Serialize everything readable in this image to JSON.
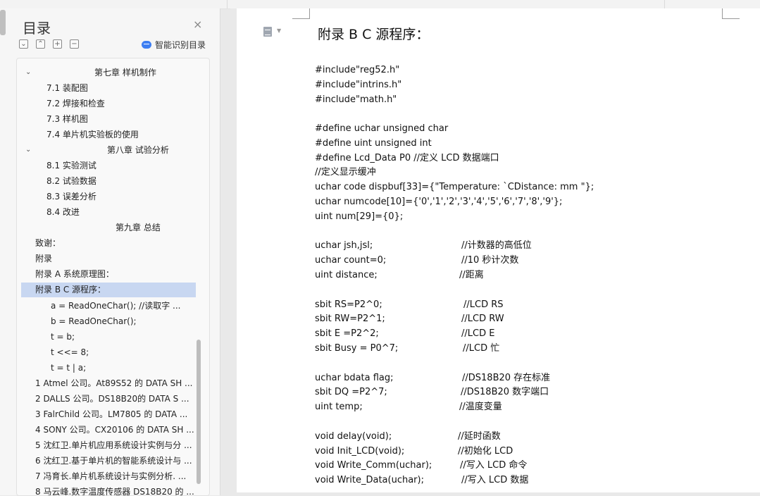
{
  "toc": {
    "title": "目录",
    "close": "×",
    "tools": [
      "⌄",
      "⌃",
      "+",
      "−"
    ],
    "smart_label": "智能识别目录",
    "items": [
      "第七章  样机制作",
      "7.1  装配图",
      "7.2  焊接和检查",
      "7.3  样机图",
      "7.4  单片机实验板的使用",
      "第八章  试验分析",
      "8.1  实验测试",
      "8.2  试验数据",
      "8.3  误差分析",
      "8.4  改进",
      "第九章  总结",
      "致谢：",
      "附录",
      "附录 A    系统原理图：",
      "附录 B  C 源程序：",
      "a  =  ReadOneChar();    //读取字 ...",
      "b  =  ReadOneChar();",
      "t  =  b;",
      "t  <<=  8;",
      "t  =  t  |  a;",
      "1  Atmel 公司。At89S52 的 DATA  SH ...",
      "2  DALLS 公司。DS18B20的 DATA  S ...",
      "3  FalrChild 公司。LM7805 的 DATA  ...",
      "4  SONY 公司。CX20106 的 DATA  SH ...",
      "5  沈红卫.单片机应用系统设计实例与分 ...",
      "6  沈红卫.基于单片机的智能系统设计与 ...",
      "7  冯育长.单片机系统设计与实例分析. ...",
      "8  马云峰.数字温度传感器 DS18B20 的 ..."
    ]
  },
  "doc": {
    "heading": "附录 B  C 源程序：",
    "lines": [
      {
        "code": "#include\"reg52.h\"",
        "comment": ""
      },
      {
        "code": "#include\"intrins.h\"",
        "comment": ""
      },
      {
        "code": "#include\"math.h\"",
        "comment": ""
      },
      {
        "code": "#define  uchar  unsigned  char",
        "comment": ""
      },
      {
        "code": "#define  uint    unsigned  int",
        "comment": ""
      },
      {
        "code": "#define  Lcd_Data    P0  //定义 LCD 数据端口",
        "comment": ""
      },
      {
        "code": "//定义显示缓冲",
        "comment": ""
      },
      {
        "code": "uchar  code  dispbuf[33]={\"Temperature:    `CDistance:        mm  \"};",
        "comment": ""
      },
      {
        "code": "uchar  numcode[10]={'0','1','2','3','4','5','6','7','8','9'};",
        "comment": ""
      },
      {
        "code": "uint  num[29]={0};",
        "comment": ""
      },
      {
        "code": "uchar  jsh,jsl;",
        "comment": "//计数器的高低位"
      },
      {
        "code": "uchar  count=0;",
        "comment": "//10 秒计次数"
      },
      {
        "code": "uint  distance;",
        "comment": "//距离"
      },
      {
        "code": "sbit    RS=P2^0;",
        "comment": "//LCD    RS"
      },
      {
        "code": "sbit    RW=P2^1;",
        "comment": "//LCD  RW"
      },
      {
        "code": "sbit    E  =P2^2;",
        "comment": "//LCD  E"
      },
      {
        "code": "sbit    Busy  =  P0^7;",
        "comment": "//LCD  忙"
      },
      {
        "code": "uchar  bdata  flag;",
        "comment": "//DS18B20 存在标准"
      },
      {
        "code": "sbit  DQ          =P2^7;",
        "comment": "//DS18B20 数字端口"
      },
      {
        "code": "uint  temp;",
        "comment": "//温度变量"
      },
      {
        "code": "void  delay(void);",
        "comment": "//延时函数"
      },
      {
        "code": "void  Init_LCD(void);",
        "comment": "//初始化 LCD"
      },
      {
        "code": "void  Write_Comm(uchar);",
        "comment": "//写入 LCD 命令"
      },
      {
        "code": "void  Write_Data(uchar);",
        "comment": "//写入 LCD 数据"
      }
    ]
  }
}
